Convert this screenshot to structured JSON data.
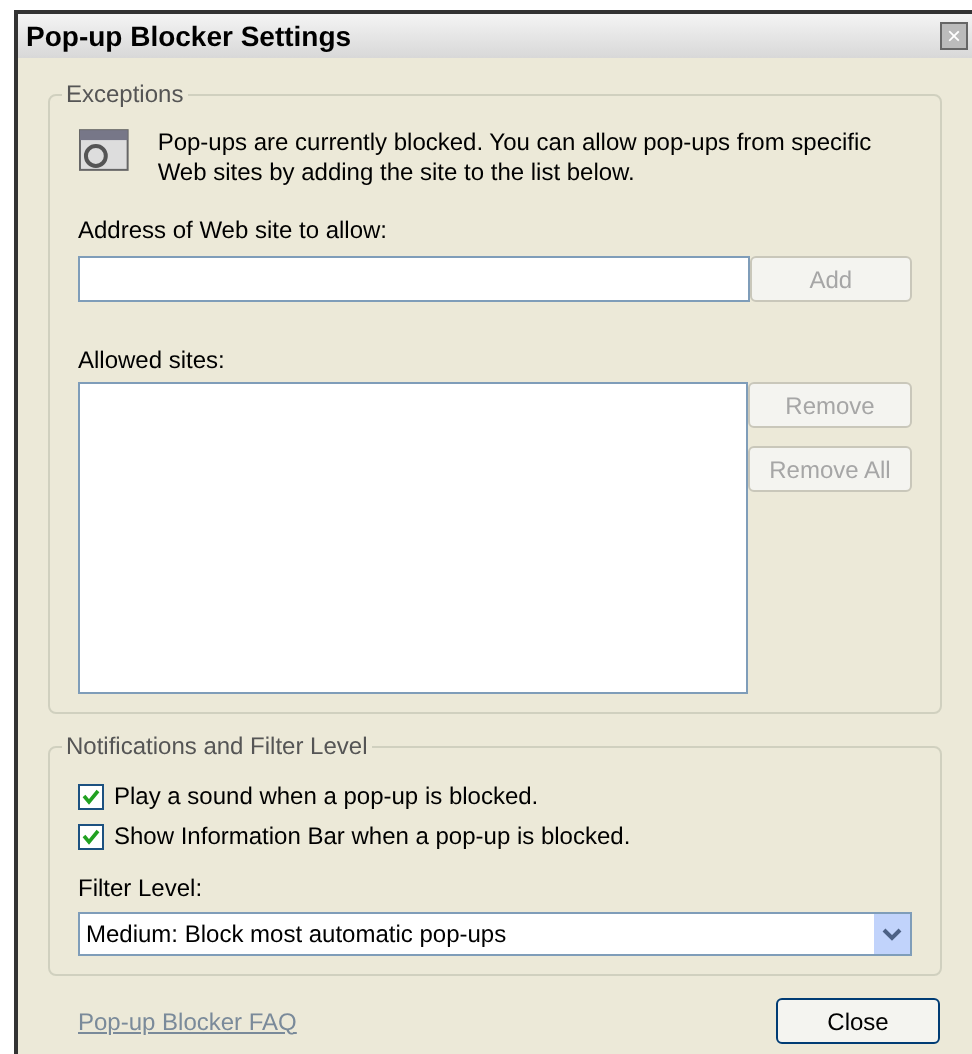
{
  "window": {
    "title": "Pop-up Blocker Settings",
    "close_glyph": "×"
  },
  "exceptions": {
    "legend": "Exceptions",
    "message": "Pop-ups are currently blocked.  You can allow pop-ups from specific Web sites by adding the site to the list below.",
    "address_label": "Address of Web site to allow:",
    "add_button": {
      "label": "Add",
      "disabled": true
    },
    "allowed_label": "Allowed sites:",
    "buttons": [
      {
        "label": "Remove",
        "disabled": true
      },
      {
        "label": "Remove All",
        "disabled": true
      }
    ]
  },
  "notifications": {
    "legend": "Notifications and Filter Level",
    "checkboxes": [
      {
        "label": "Play a sound when a pop-up is blocked.",
        "checked": true
      },
      {
        "label": "Show Information Bar when a pop-up is blocked.",
        "checked": true
      }
    ],
    "filter_label": "Filter Level:",
    "filter_value": "Medium: Block most automatic pop-ups"
  },
  "footer": {
    "link": "Pop-up Blocker FAQ",
    "close_button": "Close"
  }
}
